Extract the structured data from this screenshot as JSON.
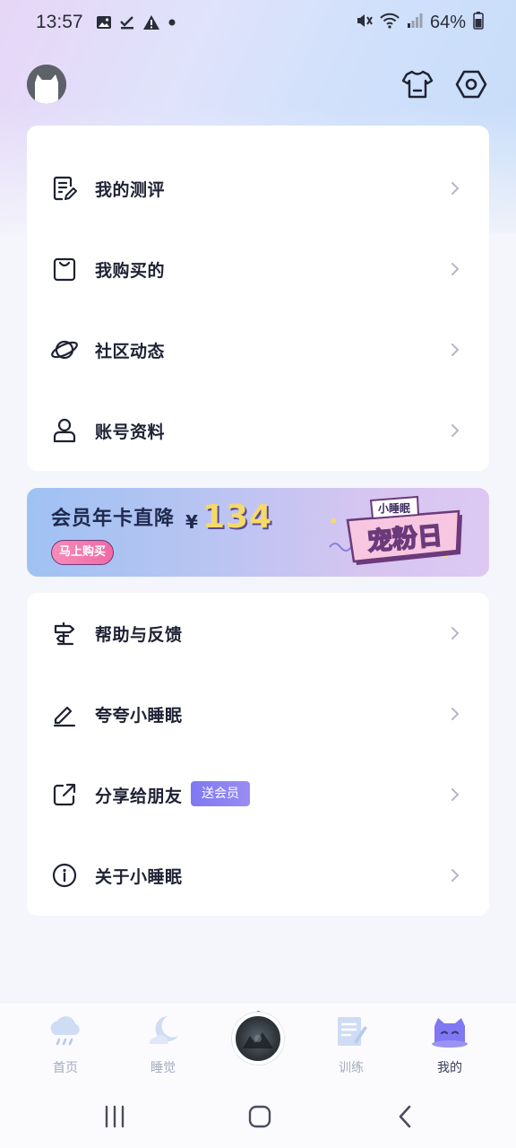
{
  "status_bar": {
    "time": "13:57",
    "battery": "64%",
    "left_icons": [
      "image-icon",
      "check-icon",
      "warning-icon",
      "dot-icon"
    ],
    "right_icons": [
      "mute-icon",
      "wifi-icon",
      "signal-icon",
      "battery-icon"
    ]
  },
  "header": {
    "avatar": "avatar",
    "icons": [
      "tshirt-icon",
      "settings-icon"
    ]
  },
  "menu_top": [
    {
      "label": "我的测评",
      "icon": "assessment-icon"
    },
    {
      "label": "我购买的",
      "icon": "shopping-bag-icon"
    },
    {
      "label": "社区动态",
      "icon": "planet-icon"
    },
    {
      "label": "账号资料",
      "icon": "user-icon"
    }
  ],
  "banner": {
    "text": "会员年卡直降",
    "yen": "¥",
    "price": "134",
    "button": "马上购买",
    "logo_small": "小睡眠",
    "logo_big": "宠粉日"
  },
  "menu_bottom": [
    {
      "label": "帮助与反馈",
      "icon": "signpost-icon"
    },
    {
      "label": "夸夸小睡眠",
      "icon": "pencil-icon"
    },
    {
      "label": "分享给朋友",
      "icon": "share-icon",
      "tag": "送会员"
    },
    {
      "label": "关于小睡眠",
      "icon": "info-icon"
    }
  ],
  "tabbar": {
    "tabs": [
      {
        "label": "首页",
        "icon": "cloud-rain-icon"
      },
      {
        "label": "睡觉",
        "icon": "moon-icon"
      },
      {
        "label": "训练",
        "icon": "notebook-icon"
      },
      {
        "label": "我的",
        "icon": "cat-icon",
        "active": true
      }
    ],
    "center": "player-disc"
  },
  "colors": {
    "accent": "#7f78f2",
    "price": "#f6d96b",
    "buy_button": "#f06aa5",
    "tab_inactive": "#a6acc0"
  }
}
